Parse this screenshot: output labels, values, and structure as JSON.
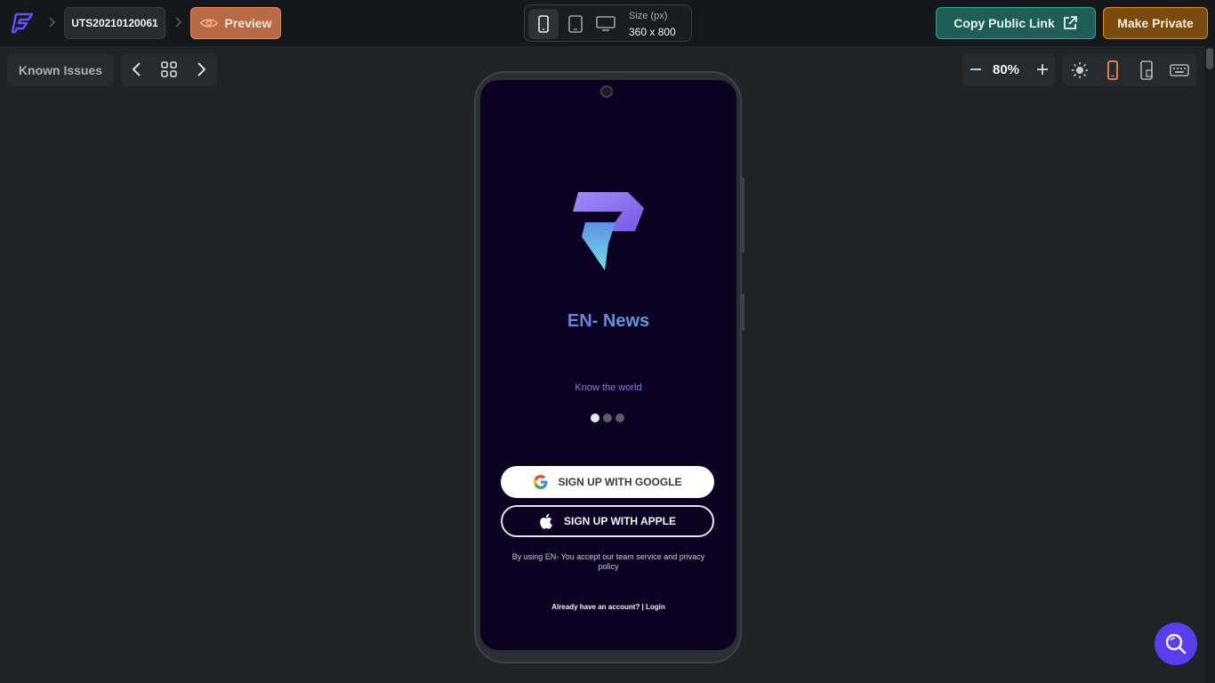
{
  "header": {
    "logo_icon": "flutterflow-logo",
    "project_id": "UTS20210120061",
    "preview_label": "Preview",
    "size_label": "Size (px)",
    "size_value": "360 x 800",
    "copy_link_label": "Copy Public Link",
    "make_private_label": "Make Private"
  },
  "toolbar": {
    "known_issues_label": "Known Issues",
    "zoom_value": "80%"
  },
  "app": {
    "title": "EN- News",
    "tagline": "Know the world",
    "google_button": "SIGN UP WITH GOOGLE",
    "apple_button": "SIGN UP WITH APPLE",
    "legal_text": "By using EN- You accept our team service and privacy policy",
    "login_text": "Already have an account? | Login",
    "carousel_active_index": 0,
    "carousel_count": 3
  },
  "colors": {
    "preview_accent": "#e58b5c",
    "copy_link_accent": "#36a594",
    "make_private_accent": "#d8901f",
    "screen_bg": "#0b0221",
    "fab_bg": "#5a3df0"
  }
}
